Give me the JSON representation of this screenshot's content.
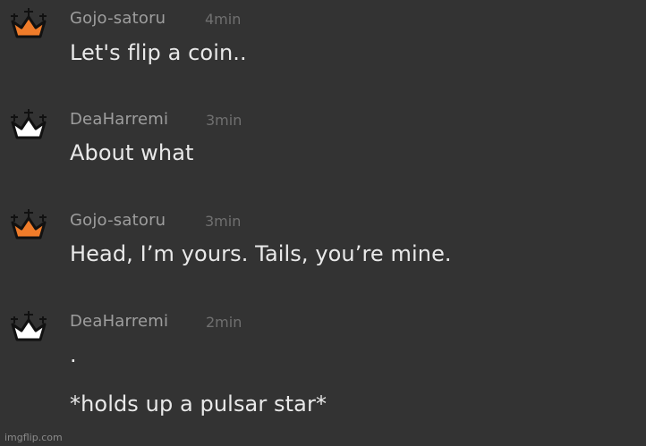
{
  "messages": [
    {
      "user": "Gojo-satoru",
      "time": "4min",
      "lines": [
        "Let's flip a coin.."
      ],
      "crown_color": "#f07c2a"
    },
    {
      "user": "DeaHarremi",
      "time": "3min",
      "lines": [
        "About what"
      ],
      "crown_color": "#ffffff"
    },
    {
      "user": "Gojo-satoru",
      "time": "3min",
      "lines": [
        "Head, I’m yours. Tails, you’re mine."
      ],
      "crown_color": "#f07c2a"
    },
    {
      "user": "DeaHarremi",
      "time": "2min",
      "lines": [
        ".",
        "*holds up a pulsar star*"
      ],
      "crown_color": "#ffffff"
    }
  ],
  "icons": {
    "avatar": "crown-icon"
  },
  "watermark": "imgflip.com"
}
